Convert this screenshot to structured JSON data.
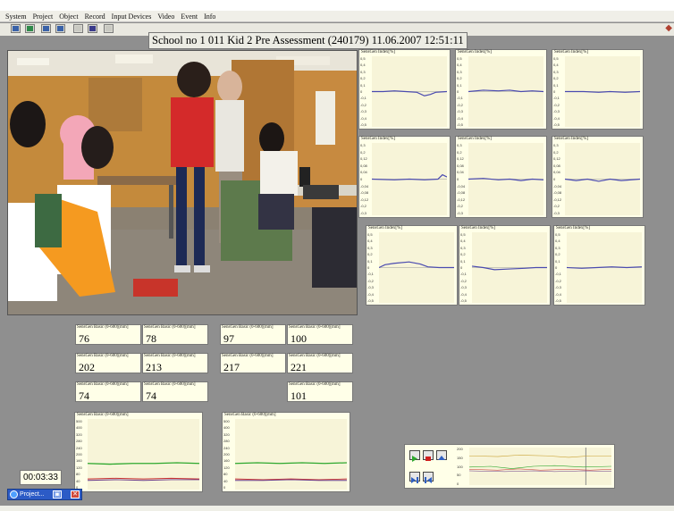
{
  "menu": [
    "System",
    "Project",
    "Object",
    "Record",
    "Input Devices",
    "Video",
    "Event",
    "Info"
  ],
  "session_title": "School no 1 011 Kid 2 Pre Assessment (240179) 11.06.2007 12:51:11",
  "index_panel_label": "SensGen Index[%]",
  "index_ticks": [
    [
      "0,5",
      "0,4",
      "0,3",
      "0,2",
      "0,1",
      "0",
      "-0,1",
      "-0,2",
      "-0,3",
      "-0,4",
      "-0,5"
    ],
    [
      "0,5",
      "0,4",
      "0,3",
      "0,2",
      "0,1",
      "0",
      "-0,1",
      "-0,2",
      "-0,3",
      "-0,4",
      "-0,5"
    ],
    [
      "0,5",
      "0,4",
      "0,3",
      "0,2",
      "0,1",
      "0",
      "-0,1",
      "-0,2",
      "-0,3",
      "-0,4",
      "-0,5"
    ],
    [
      "0,3",
      "0,2",
      "0,12",
      "0,08",
      "0,04",
      "0",
      "-0,04",
      "-0,08",
      "-0,12",
      "-0,2",
      "-0,3"
    ],
    [
      "0,3",
      "0,2",
      "0,12",
      "0,08",
      "0,04",
      "0",
      "-0,04",
      "-0,08",
      "-0,12",
      "-0,2",
      "-0,3"
    ],
    [
      "0,3",
      "0,2",
      "0,12",
      "0,08",
      "0,04",
      "0",
      "-0,04",
      "-0,08",
      "-0,12",
      "-0,2",
      "-0,3"
    ],
    [
      "0,5",
      "0,4",
      "0,3",
      "0,2",
      "0,1",
      "0",
      "-0,1",
      "-0,2",
      "-0,3",
      "-0,4",
      "-0,5"
    ],
    [
      "0,5",
      "0,4",
      "0,3",
      "0,2",
      "0,1",
      "0",
      "-0,1",
      "-0,2",
      "-0,3",
      "-0,4",
      "-0,5"
    ],
    [
      "0,5",
      "0,4",
      "0,3",
      "0,2",
      "0,1",
      "0",
      "-0,1",
      "-0,2",
      "-0,3",
      "-0,4",
      "-0,5"
    ]
  ],
  "basic_label": "SensGen Basic (0-600)[mm]",
  "basic_values": [
    "76",
    "78",
    "97",
    "100",
    "202",
    "213",
    "217",
    "221",
    "74",
    "74",
    "101"
  ],
  "basic_chart_ticks": [
    "500",
    "400",
    "320",
    "280",
    "240",
    "200",
    "160",
    "120",
    "80",
    "40",
    "0"
  ],
  "timer": "00:03:33",
  "taskbar_label": "Project...",
  "taskbar_buttons": [
    "▣",
    "✕"
  ],
  "control_ticks": [
    "200",
    "150",
    "100",
    "50",
    "0"
  ],
  "colors": {
    "index_line": "#4a4ab0",
    "green_line": "#2ea82e",
    "red_line": "#c83232",
    "purple_line": "#6a3a8a",
    "panel_bg": "#ffffe8"
  },
  "icons": [
    "open-icon",
    "save-icon",
    "list-icon",
    "monitor-icon",
    "disabled-icon",
    "pencil-icon",
    "disabled2-icon"
  ]
}
